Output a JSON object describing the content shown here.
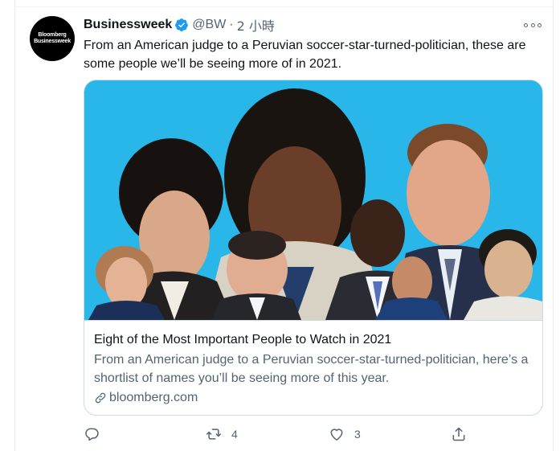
{
  "tweet": {
    "avatar_lines": [
      "Bloomberg",
      "Businessweek"
    ],
    "name": "Businessweek",
    "handle": "@BW",
    "separator": "·",
    "time": "2 小時",
    "text": "From an American judge to a Peruvian soccer-star-turned-politician, these are some people we’ll be seeing more of in 2021."
  },
  "card": {
    "title": "Eight of the Most Important People to Watch in 2021",
    "description": "From an American judge to a Peruvian soccer-star-turned-politician, here’s a shortlist of names you’ll be seeing more of this year.",
    "domain": "bloomberg.com"
  },
  "actions": {
    "reply_count": "",
    "retweet_count": "4",
    "like_count": "3"
  },
  "icons": {
    "verified": "verified-badge-icon",
    "more": "more-options-icon",
    "link": "link-icon",
    "reply": "reply-icon",
    "retweet": "retweet-icon",
    "like": "like-icon",
    "share": "share-icon"
  },
  "colors": {
    "verified_blue": "#1d9bf0",
    "image_background": "#29b6e8",
    "secondary_text": "#536471"
  }
}
